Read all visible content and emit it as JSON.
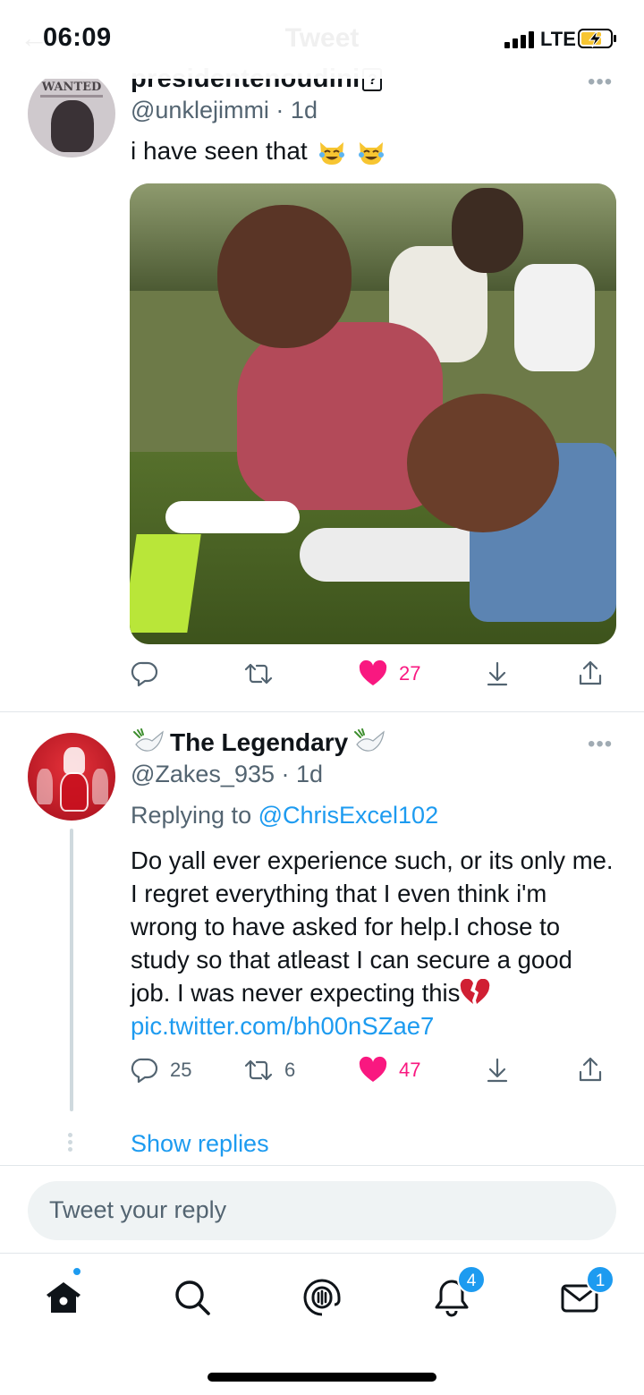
{
  "status_bar": {
    "time": "06:09",
    "network": "LTE",
    "header_title_faded": "Tweet",
    "icons": [
      "back-arrow-icon",
      "signal-icon",
      "battery-charging-icon"
    ]
  },
  "tweet1": {
    "display_name": "presidentenoudini",
    "handle_time": "@unklejimmi · 1d",
    "avatar_text": "WANTED",
    "text": "i have seen that",
    "emoji": [
      "joy-cat-emoji",
      "joy-cat-emoji"
    ],
    "more_label": "•••",
    "actions": {
      "reply_count": "",
      "retweet_count": "",
      "like_count": "27",
      "liked": true
    }
  },
  "tweet2": {
    "display_name": "The Legendary",
    "handle_time": "@Zakes_935 · 1d",
    "replying_prefix": "Replying to ",
    "replying_handle": "@ChrisExcel102",
    "text": "Do yall ever experience such, or its only me. I regret everything that I even think i'm wrong to have asked for help.I chose to study so that atleast I can secure a good job. I was never expecting this",
    "link": "pic.twitter.com/bh00nSZae7",
    "more_label": "•••",
    "actions": {
      "reply_count": "25",
      "retweet_count": "6",
      "like_count": "47",
      "liked": true
    },
    "show_replies": "Show replies"
  },
  "reply_box": {
    "placeholder": "Tweet your reply"
  },
  "tab_bar": {
    "tabs": [
      "home-icon",
      "search-icon",
      "spaces-icon",
      "notifications-icon",
      "messages-icon"
    ],
    "notifications_badge": "4",
    "messages_badge": "1"
  },
  "colors": {
    "accent": "#1d9bf0",
    "like": "#f91880",
    "muted": "#536471"
  }
}
